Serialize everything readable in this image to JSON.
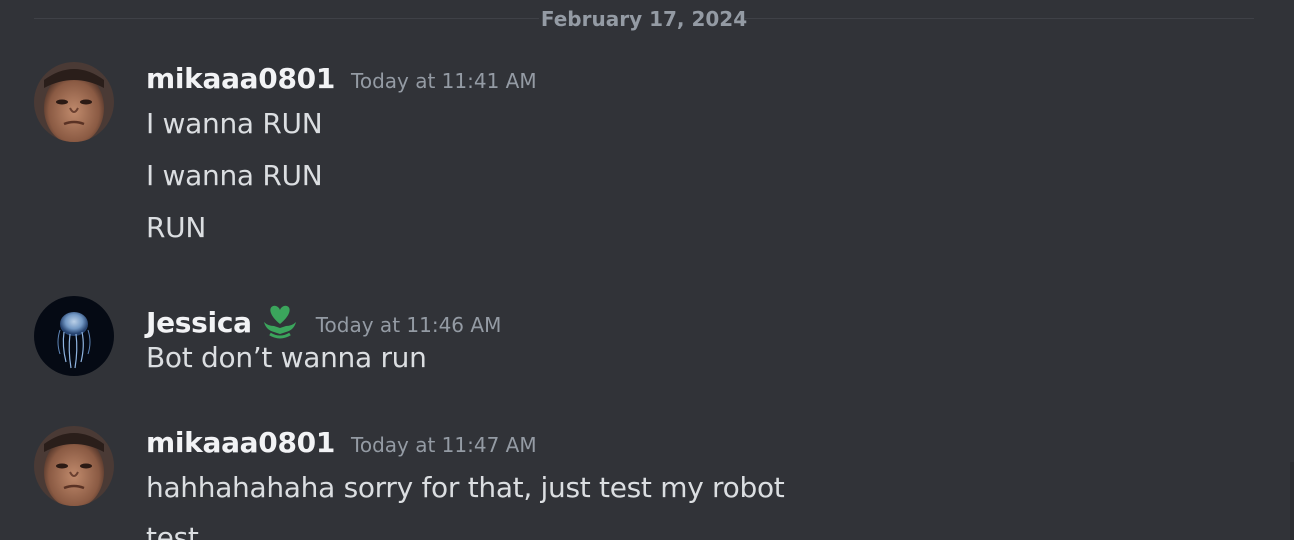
{
  "divider": {
    "date": "February 17, 2024"
  },
  "messages": [
    {
      "username": "mikaaa0801",
      "timestamp": "Today at 11:41 AM",
      "lines": [
        "I wanna RUN",
        "I wanna RUN",
        "RUN"
      ]
    },
    {
      "username": "Jessica",
      "badge_icon": "green-heart-hands-icon",
      "timestamp": "Today at 11:46 AM",
      "lines": [
        "Bot don’t wanna run"
      ]
    },
    {
      "username": "mikaaa0801",
      "timestamp": "Today at 11:47 AM",
      "lines": [
        "hahhahahaha sorry for that, just test my robot",
        "test"
      ]
    }
  ],
  "colors": {
    "background": "#313338",
    "username": "#f2f3f5",
    "message_text": "#dbdee1",
    "muted": "#949ba4",
    "badge_green": "#3ba55c"
  }
}
